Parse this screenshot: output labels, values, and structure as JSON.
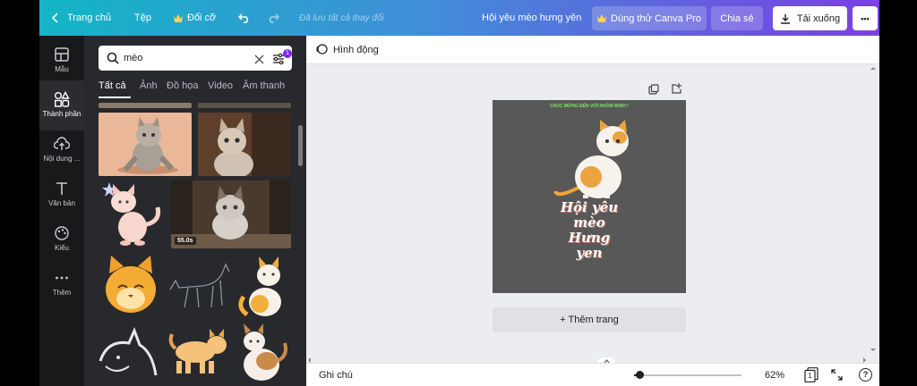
{
  "topbar": {
    "home": "Trang chủ",
    "file": "Tệp",
    "resize": "Đổi cỡ",
    "saved": "Đã lưu tất cả thay đổi",
    "design_title": "Hội yêu mèo hưng yên",
    "try_pro": "Dùng thử Canva Pro",
    "share": "Chia sẻ",
    "download": "Tải xuống",
    "more": "•••"
  },
  "nav": [
    {
      "label": "Mẫu",
      "icon": "template-icon"
    },
    {
      "label": "Thành phần",
      "icon": "elements-icon"
    },
    {
      "label": "Nội dung ...",
      "icon": "upload-icon"
    },
    {
      "label": "Văn bản",
      "icon": "text-icon"
    },
    {
      "label": "Kiểu",
      "icon": "palette-icon"
    },
    {
      "label": "Thêm",
      "icon": "more-icon"
    }
  ],
  "search": {
    "value": "mèo",
    "filter_count": "1"
  },
  "tabs": [
    "Tất cả",
    "Ảnh",
    "Đồ họa",
    "Video",
    "Âm thanh"
  ],
  "results": {
    "video_duration": "55.0s"
  },
  "editor": {
    "animate": "Hình động",
    "add_page": "+ Thêm trang"
  },
  "design": {
    "banner": "CHÚC MỪNG ĐẾN VỚI NHÓM MÌNH !",
    "title_lines": [
      "Hội yêu",
      "mèo",
      "Hưng",
      "yen"
    ],
    "background": "#585858"
  },
  "footer": {
    "notes": "Ghi chú",
    "zoom": "62%",
    "page_count": "1",
    "help": "?",
    "zoom_level": 0.05
  },
  "colors": {
    "accent_purple": "#7d2ae8",
    "panel_bg": "#28292d",
    "nav_bg": "#18191b"
  }
}
